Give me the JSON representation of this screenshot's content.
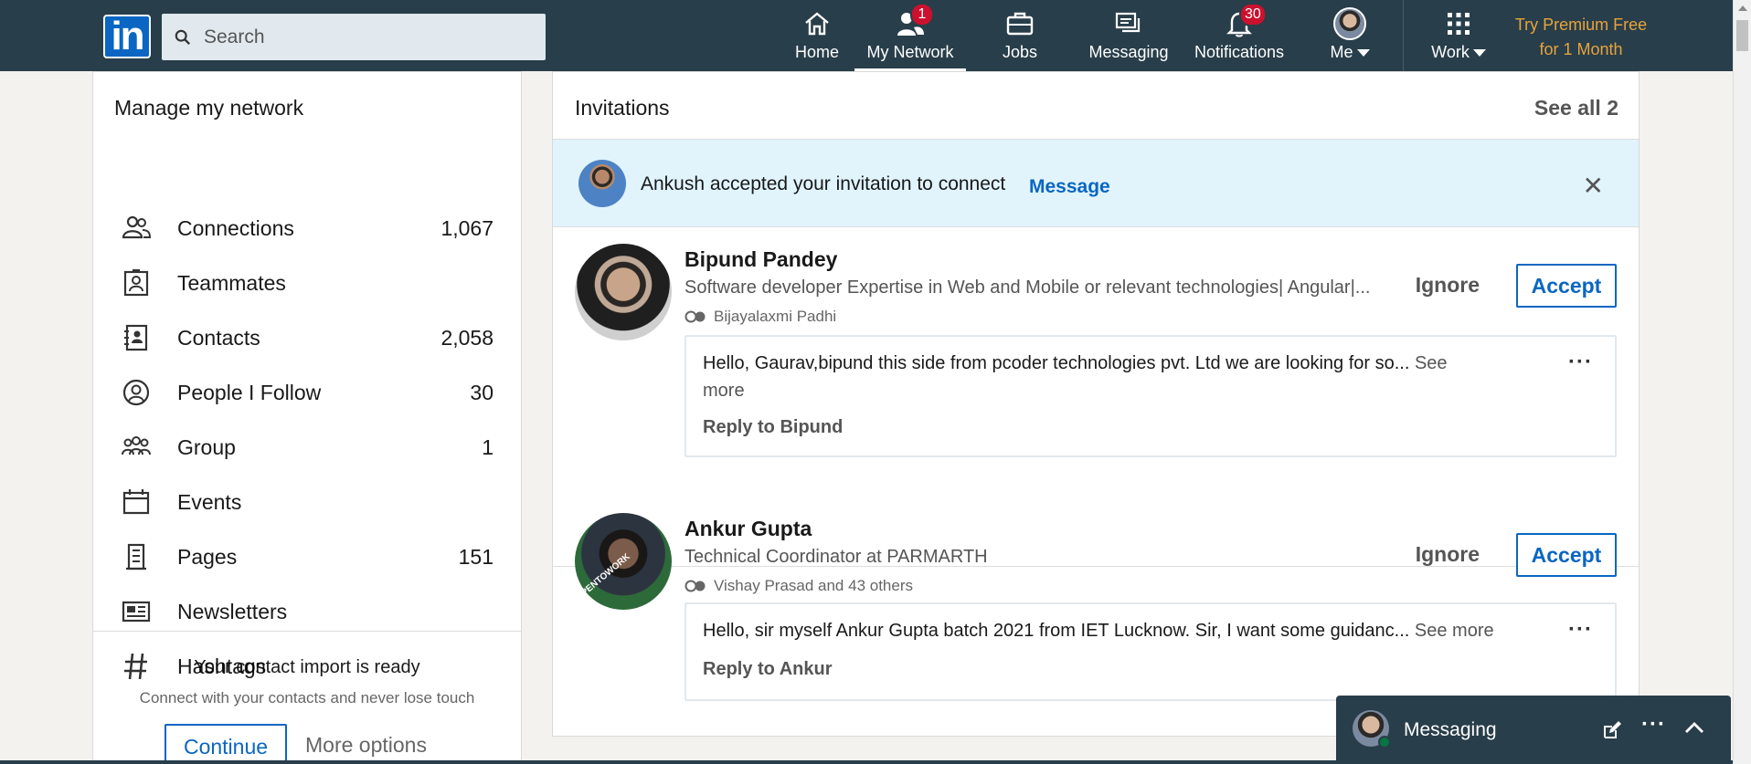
{
  "nav": {
    "search_placeholder": "Search",
    "items": [
      {
        "label": "Home",
        "icon": "home-icon"
      },
      {
        "label": "My Network",
        "icon": "people-icon",
        "badge": "1"
      },
      {
        "label": "Jobs",
        "icon": "briefcase-icon"
      },
      {
        "label": "Messaging",
        "icon": "chat-icon"
      },
      {
        "label": "Notifications",
        "icon": "bell-icon",
        "badge": "30"
      },
      {
        "label": "Me",
        "icon": "avatar"
      },
      {
        "label": "Work",
        "icon": "grid-icon"
      }
    ],
    "premium_line1": "Try Premium Free",
    "premium_line2": "for 1 Month",
    "brand_color": "#0a66c2",
    "bar_color": "#283e4a"
  },
  "network": {
    "title": "Manage my network",
    "items": [
      {
        "label": "Connections",
        "count": "1,067",
        "icon": "connections-icon"
      },
      {
        "label": "Teammates",
        "count": "",
        "icon": "teammates-icon"
      },
      {
        "label": "Contacts",
        "count": "2,058",
        "icon": "contacts-icon"
      },
      {
        "label": "People I Follow",
        "count": "30",
        "icon": "follow-icon"
      },
      {
        "label": "Group",
        "count": "1",
        "icon": "group-icon"
      },
      {
        "label": "Events",
        "count": "",
        "icon": "calendar-icon"
      },
      {
        "label": "Pages",
        "count": "151",
        "icon": "building-icon"
      },
      {
        "label": "Newsletters",
        "count": "",
        "icon": "newsletter-icon"
      },
      {
        "label": "Hashtags",
        "count": "",
        "icon": "hashtag-icon"
      }
    ],
    "import_title": "Your contact import is ready",
    "import_sub": "Connect with your contacts and never lose touch",
    "continue_label": "Continue",
    "more_options_label": "More options"
  },
  "invitations": {
    "title": "Invitations",
    "see_all": "See all 2",
    "accepted_text": "Ankush accepted your invitation to connect",
    "accepted_message": "Message",
    "ignore_label": "Ignore",
    "accept_label": "Accept",
    "list": [
      {
        "name": "Bipund Pandey",
        "headline": "Software developer Expertise in Web and Mobile or relevant technologies| Angular|...",
        "mutual": "Bijayalaxmi Padhi",
        "message": "Hello, Gaurav,bipund this side from pcoder technologies pvt. Ltd we are looking for so...",
        "see_more_part1": "See",
        "see_more_part2": "more",
        "reply": "Reply to Bipund"
      },
      {
        "name": "Ankur Gupta",
        "headline": "Technical Coordinator at PARMARTH",
        "mutual": "Vishay Prasad and 43 others",
        "message": "Hello, sir myself Ankur Gupta batch 2021 from IET Lucknow. Sir, I want some guidanc...",
        "see_more": "See more",
        "reply": "Reply to Ankur",
        "badge_text": "#OPENTOWORK"
      }
    ]
  },
  "messaging_dock": {
    "title": "Messaging"
  }
}
